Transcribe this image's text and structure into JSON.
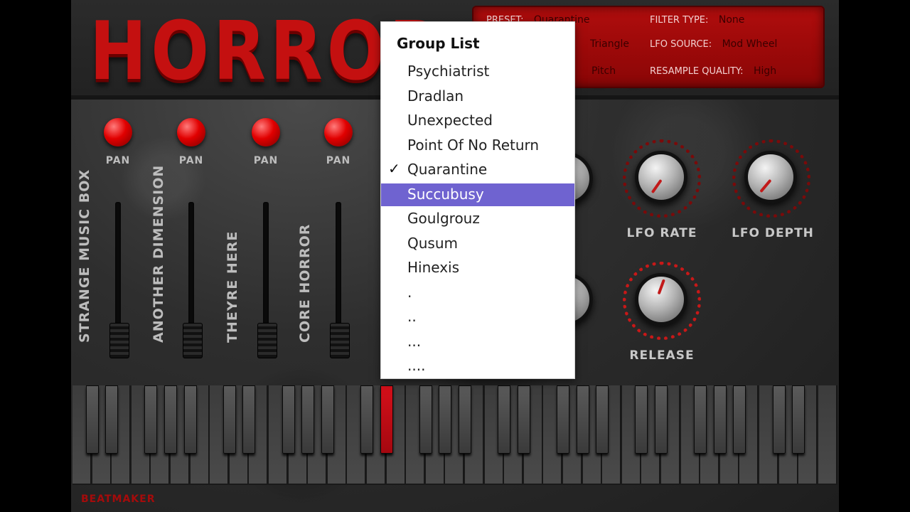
{
  "logo": {
    "text": "HORROR BOX"
  },
  "info_panel": {
    "preset_key": "PRESET:",
    "preset_value": "Quarantine",
    "lfo_shape_value": "Triangle",
    "lfo_target_value": "Pitch",
    "filter_type_key": "FILTER TYPE:",
    "filter_type_value": "None",
    "lfo_source_key": "LFO SOURCE:",
    "lfo_source_value": "Mod Wheel",
    "resample_quality_key": "RESAMPLE QUALITY:",
    "resample_quality_value": "High"
  },
  "channels": [
    {
      "pan_label": "PAN",
      "name": "STRANGE MUSIC BOX"
    },
    {
      "pan_label": "PAN",
      "name": "ANOTHER DIMENSION"
    },
    {
      "pan_label": "PAN",
      "name": "THEYRE HERE"
    },
    {
      "pan_label": "PAN",
      "name": "CORE HORROR"
    }
  ],
  "knobs": {
    "lfo_rate": "LFO RATE",
    "lfo_depth": "LFO DEPTH",
    "release": "RELEASE"
  },
  "brand": "BEATMAKER",
  "group_menu": {
    "title": "Group List",
    "check_glyph": "✓",
    "items": [
      "Psychiatrist",
      "Dradlan",
      "Unexpected",
      "Point Of No Return",
      "Quarantine",
      "Succubusy",
      "Goulgrouz",
      "Qusum",
      "Hinexis",
      ".",
      "..",
      "...",
      "...."
    ],
    "checked_item": "Quarantine",
    "highlighted_item": "Succubusy"
  },
  "colors": {
    "accent_red": "#c41010",
    "menu_highlight": "#6f63d0"
  }
}
